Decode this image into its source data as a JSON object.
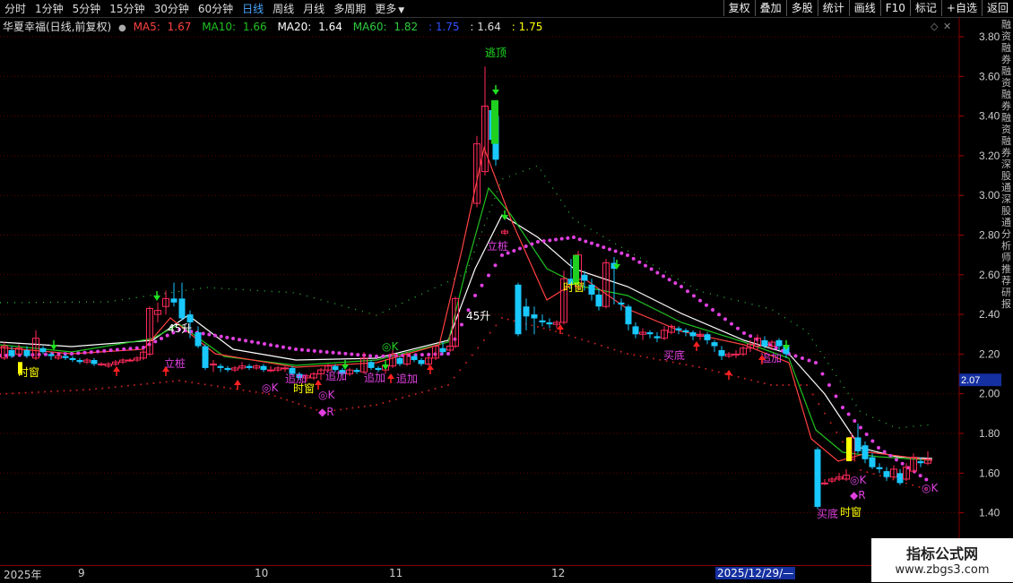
{
  "toolbar": {
    "tabs": [
      "分时",
      "1分钟",
      "5分钟",
      "15分钟",
      "30分钟",
      "60分钟",
      "日线",
      "周线",
      "月线",
      "多周期",
      "更多"
    ],
    "active_tab": "日线",
    "right_buttons": [
      "复权",
      "叠加",
      "多股",
      "统计",
      "画线",
      "F10",
      "标记",
      "+自选",
      "返回"
    ]
  },
  "info": {
    "stock": "华夏幸福(日线,前复权)",
    "ma5_label": "MA5:",
    "ma5": "1.67",
    "ma10_label": "MA10:",
    "ma10": "1.66",
    "ma20_label": "MA20:",
    "ma20": "1.64",
    "ma60_label": "MA60:",
    "ma60": "1.82",
    "extra1": "1.75",
    "extra2": "1.64",
    "extra3": "1.75"
  },
  "price_axis": {
    "ticks": [
      "3.80",
      "3.60",
      "3.40",
      "3.20",
      "3.00",
      "2.80",
      "2.60",
      "2.40",
      "2.20",
      "2.00",
      "1.80",
      "1.60",
      "1.40"
    ],
    "current_price": "2.07"
  },
  "dates": {
    "year": "2025年",
    "m9": "9",
    "m10": "10",
    "m11": "11",
    "m12": "12",
    "cursor": "2025/12/29/—"
  },
  "signals": {
    "top": "逃顶",
    "stake": "立桩",
    "stake2": "立桩",
    "plus1": "追加",
    "plus2": "追加",
    "plus3": "追加",
    "plus4": "追加",
    "plus5": "追加",
    "window1": "时窗",
    "window2": "时窗",
    "window3": "时窗",
    "window4": "时窗",
    "buy1": "买底",
    "buy2": "买底",
    "ok1": "◎K",
    "ok2": "◎K",
    "ok3": "◎K",
    "ok4": "◎K",
    "r1": "◆R",
    "r2": "◆R",
    "a45_1": "45升",
    "a45_2": "45升"
  },
  "side_text": "融资融券融资融券融资融券深股通深股通分析师推荐研报",
  "watermark": {
    "line1": "指标公式网",
    "line2": "www.zbgs3.com"
  },
  "colors": {
    "up": "#ff2a5a",
    "down": "#19c8ff",
    "ma5": "#ff4040",
    "ma10": "#20c020",
    "ma20": "#ffffff",
    "ma60": "#2ecc40",
    "dot": "#e040e0",
    "yellow": "#ffff00"
  }
}
